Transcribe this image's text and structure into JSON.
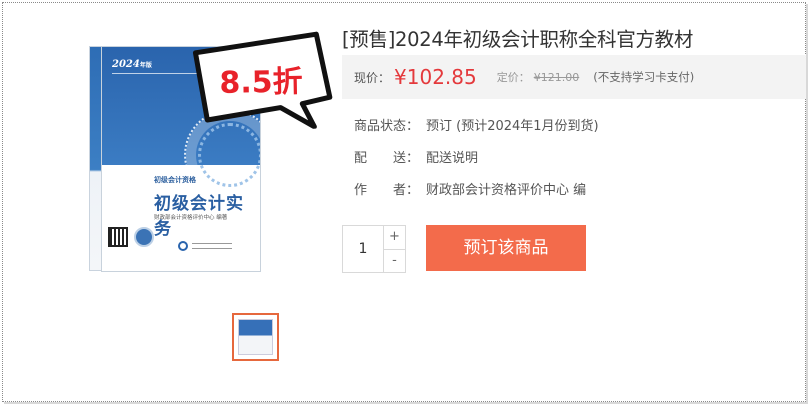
{
  "product": {
    "title": "[预售]2024年初级会计职称全科官方教材",
    "discount_badge": "8.5折",
    "book_cover": {
      "year": "2024",
      "year_suffix": "年版",
      "series": "初级会计资格",
      "title": "初级会计实务",
      "author": "财政部会计资格评价中心 编著"
    }
  },
  "price": {
    "label": "现价：",
    "current": "¥102.85",
    "orig_label": "定价：",
    "original": "¥121.00",
    "note": "(不支持学习卡支付)"
  },
  "details": [
    {
      "key": "商品状态：",
      "value": "预订 (预计2024年1月份到货)"
    },
    {
      "key": "配　　送：",
      "value": "配送说明"
    },
    {
      "key": "作　　者：",
      "value": "财政部会计资格评价中心 编"
    }
  ],
  "purchase": {
    "quantity": "1",
    "plus": "+",
    "minus": "-",
    "order_button": "预订该商品"
  },
  "colors": {
    "accent": "#f36b4b",
    "price_red": "#e4393c",
    "badge_red": "#e8222a",
    "book_blue": "#2a64ad"
  }
}
